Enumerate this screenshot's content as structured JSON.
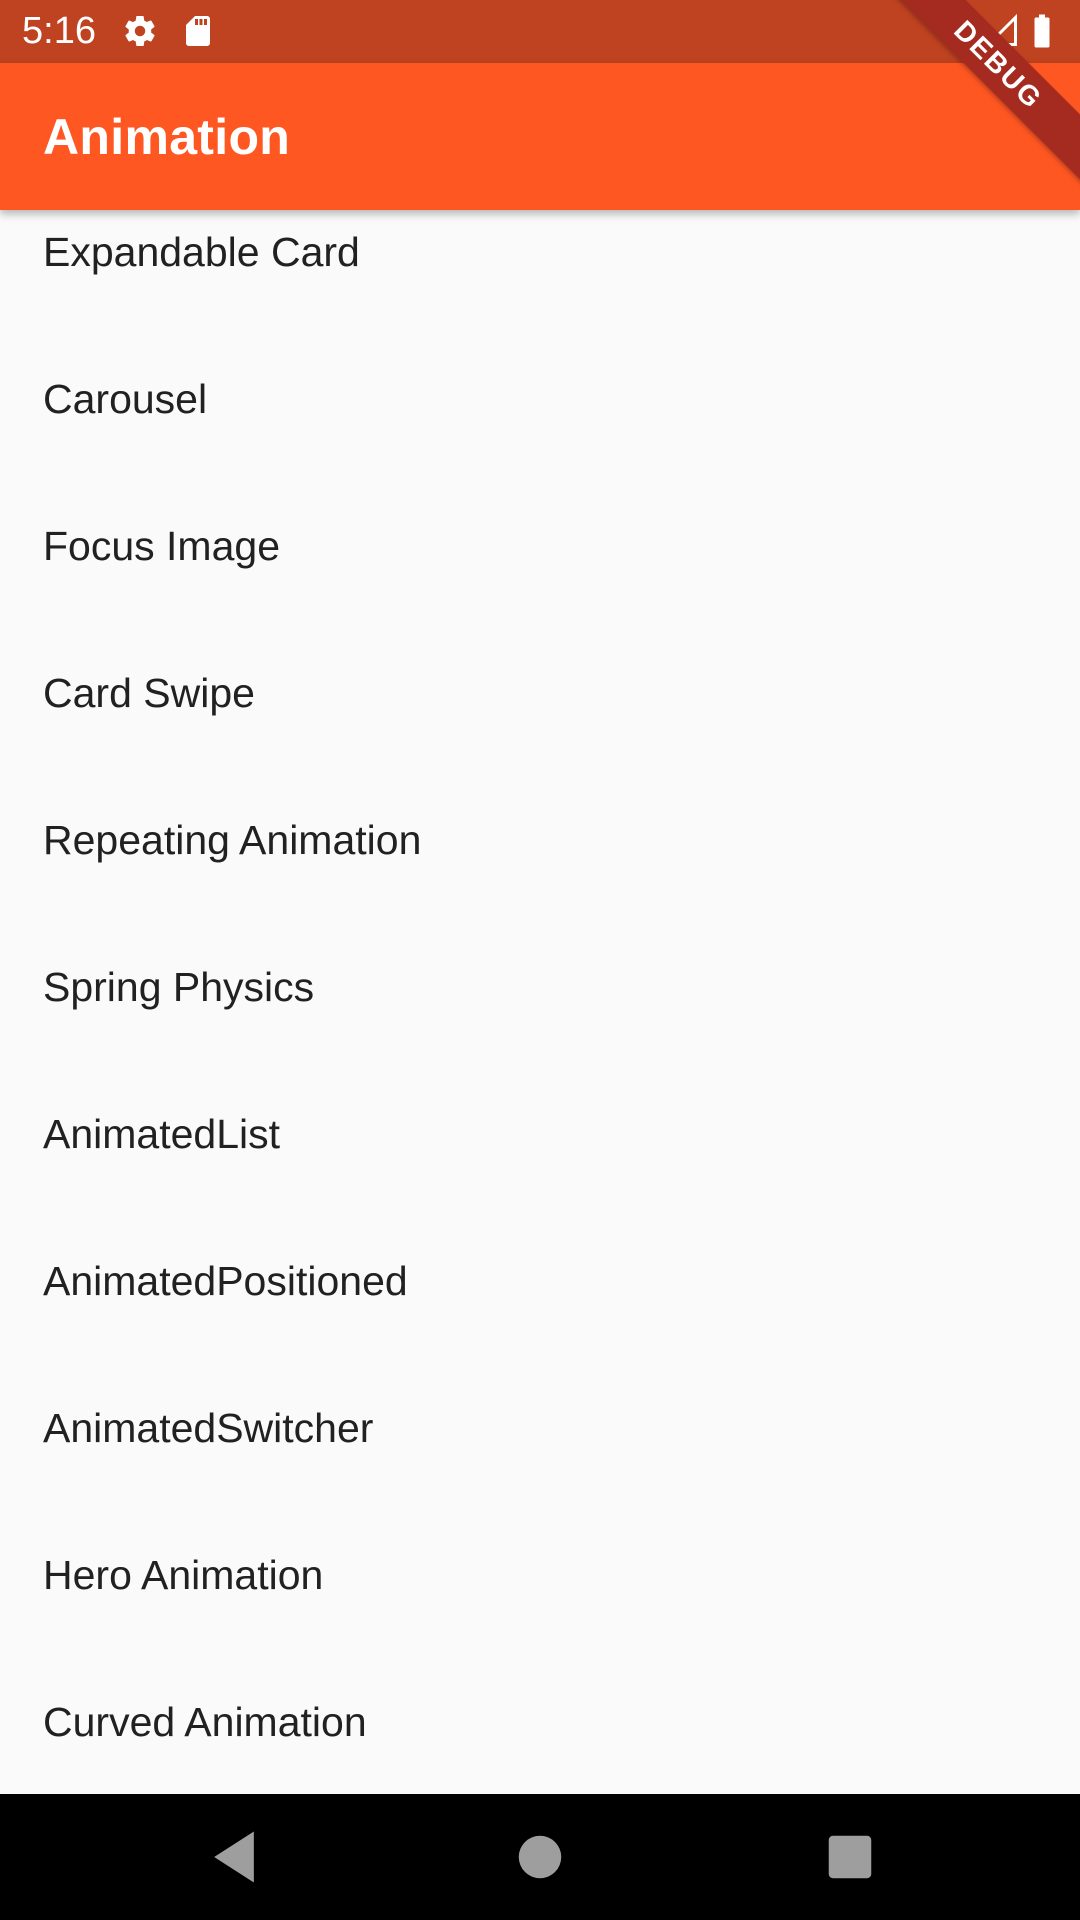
{
  "status_bar": {
    "time": "5:16",
    "icons": [
      "settings-icon",
      "sd-card-icon",
      "wifi-icon",
      "cell-signal-icon",
      "battery-icon"
    ],
    "background_color": "#bf4320"
  },
  "app_bar": {
    "title": "Animation",
    "background_color": "#ff5722"
  },
  "debug_banner": {
    "label": "DEBUG",
    "color": "#a52a1f"
  },
  "list": {
    "items": [
      {
        "label": "Expandable Card"
      },
      {
        "label": "Carousel"
      },
      {
        "label": "Focus Image"
      },
      {
        "label": "Card Swipe"
      },
      {
        "label": "Repeating Animation"
      },
      {
        "label": "Spring Physics"
      },
      {
        "label": "AnimatedList"
      },
      {
        "label": "AnimatedPositioned"
      },
      {
        "label": "AnimatedSwitcher"
      },
      {
        "label": "Hero Animation"
      },
      {
        "label": "Curved Animation"
      }
    ]
  },
  "nav_bar": {
    "buttons": [
      "back-icon",
      "home-icon",
      "recents-icon"
    ]
  }
}
